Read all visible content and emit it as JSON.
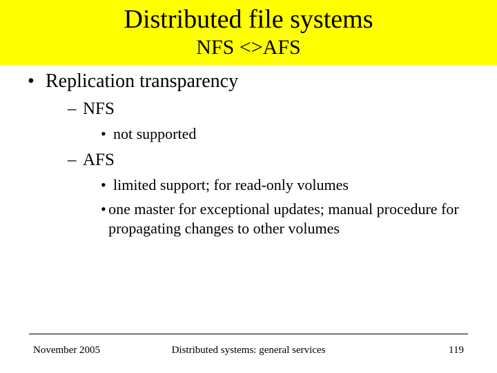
{
  "title": "Distributed file systems",
  "subtitle": "NFS <>AFS",
  "bullets": {
    "main": "Replication transparency",
    "sub1": "NFS",
    "sub1_items": [
      "not supported"
    ],
    "sub2": "AFS",
    "sub2_items": [
      "limited support; for read-only volumes",
      "one master for exceptional updates; manual procedure for propagating changes to other volumes"
    ]
  },
  "footer": {
    "date": "November 2005",
    "center": "Distributed systems: general services",
    "page": "119"
  }
}
